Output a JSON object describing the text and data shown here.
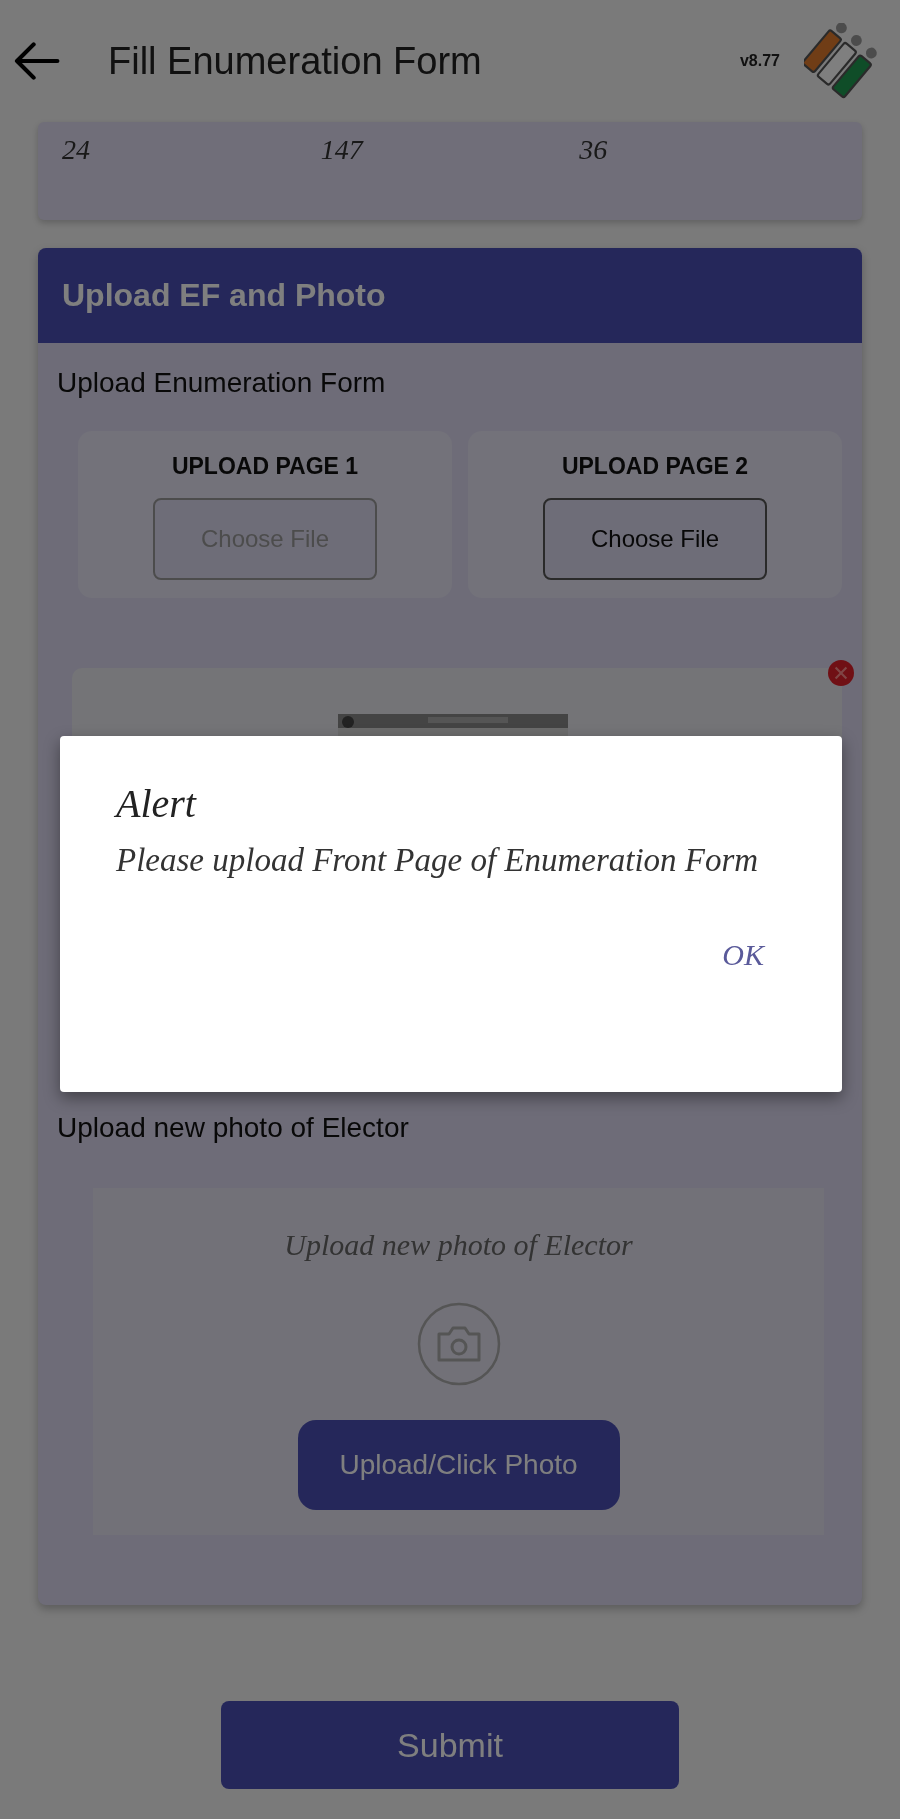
{
  "header": {
    "title": "Fill Enumeration Form",
    "version": "v8.77"
  },
  "summary_values": [
    "24",
    "147",
    "36"
  ],
  "upload_card": {
    "title": "Upload EF and Photo",
    "form_label": "Upload Enumeration Form",
    "pages": [
      {
        "label": "UPLOAD PAGE 1",
        "button": "Choose File",
        "disabled": true
      },
      {
        "label": "UPLOAD PAGE 2",
        "button": "Choose File",
        "disabled": false
      }
    ],
    "photo_label": "Upload new photo of Elector",
    "photo_hint": "Upload new photo of Elector",
    "photo_button": "Upload/Click Photo"
  },
  "submit": "Submit",
  "dialog": {
    "title": "Alert",
    "message": "Please upload Front Page of Enumeration Form",
    "button": "OK"
  }
}
